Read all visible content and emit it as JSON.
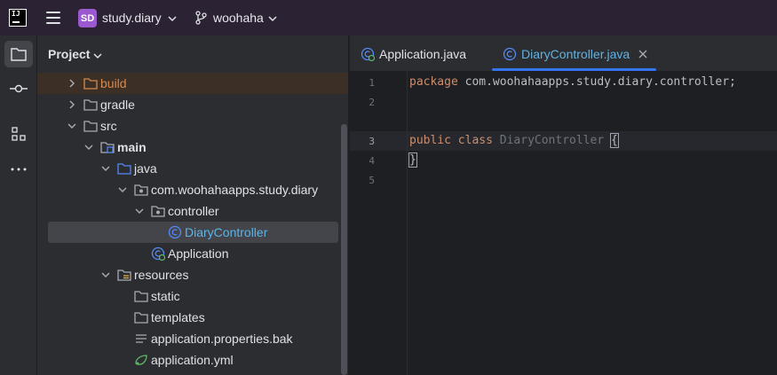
{
  "titlebar": {
    "app_logo_text": "IJ",
    "project_badge": "SD",
    "project_name": "study.diary",
    "branch_name": "woohaha"
  },
  "activity_bar": {
    "items": [
      {
        "icon": "folder-icon",
        "active": true
      },
      {
        "icon": "commit-icon",
        "active": false
      },
      {
        "icon": "structure-icon",
        "active": false
      },
      {
        "icon": "more-icon",
        "active": false
      }
    ]
  },
  "project_panel": {
    "title": "Project",
    "tree": [
      {
        "label": "build",
        "type": "folder-excluded",
        "expanded": false
      },
      {
        "label": "gradle",
        "type": "folder",
        "expanded": false
      },
      {
        "label": "src",
        "type": "folder",
        "expanded": true
      },
      {
        "label": "main",
        "type": "source-root",
        "expanded": true
      },
      {
        "label": "java",
        "type": "folder-source",
        "expanded": true
      },
      {
        "label": "com.woohahaapps.study.diary",
        "type": "package",
        "expanded": true
      },
      {
        "label": "controller",
        "type": "package",
        "expanded": true
      },
      {
        "label": "DiaryController",
        "type": "class",
        "selected": true
      },
      {
        "label": "Application",
        "type": "spring-class"
      },
      {
        "label": "resources",
        "type": "resources-folder",
        "expanded": true
      },
      {
        "label": "static",
        "type": "folder"
      },
      {
        "label": "templates",
        "type": "folder"
      },
      {
        "label": "application.properties.bak",
        "type": "text-file"
      },
      {
        "label": "application.yml",
        "type": "yaml-file"
      }
    ]
  },
  "tabs": [
    {
      "label": "Application.java",
      "active": false
    },
    {
      "label": "DiaryController.java",
      "active": true,
      "closable": true
    }
  ],
  "editor": {
    "line_numbers": [
      "1",
      "2",
      "3",
      "4",
      "5"
    ],
    "current_line": "3",
    "lines": {
      "l1_kw": "package",
      "l1_rest": " com.woohahaapps.study.diary.controller;",
      "l3_kw1": "public",
      "l3_kw2": "class",
      "l3_name": "DiaryController",
      "l3_brace": "{",
      "l4": "}"
    }
  },
  "colors": {
    "titlebar": "#2b2233",
    "panel": "#2b2d30",
    "editor_bg": "#1e1f22",
    "keyword": "#cf8e6d",
    "accent": "#3574f0",
    "build_folder": "#d8894e"
  }
}
